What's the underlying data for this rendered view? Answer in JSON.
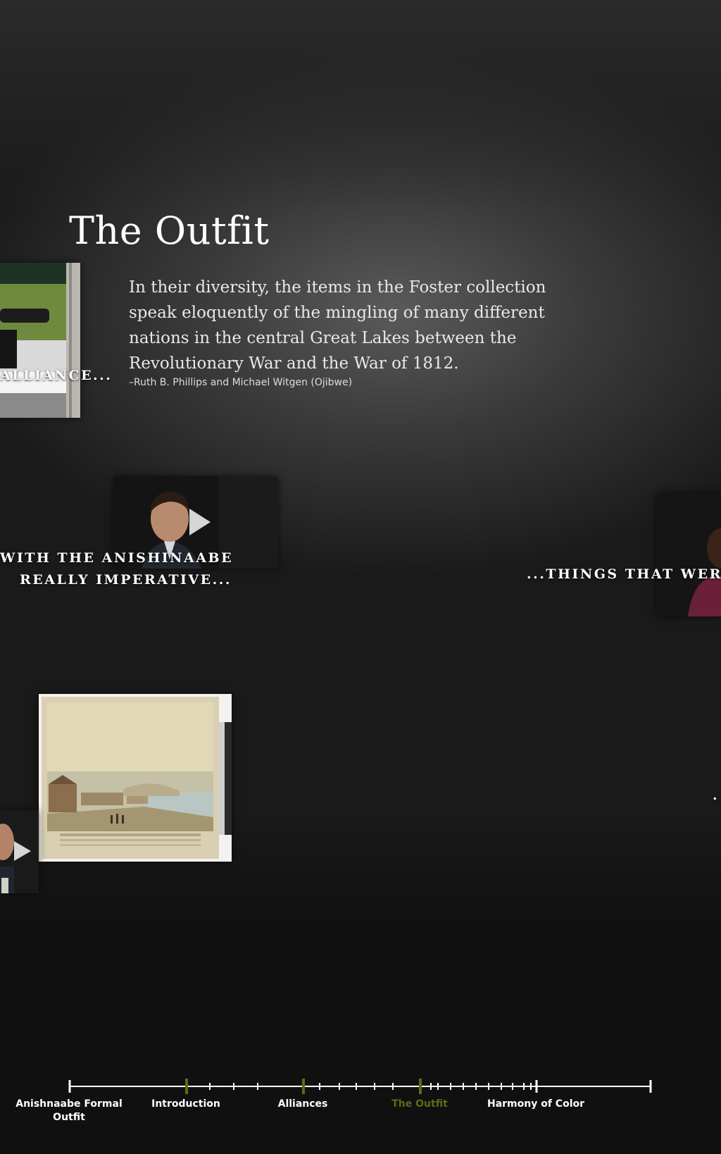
{
  "section": {
    "title": "The Outfit",
    "quote": "In their diversity, the items in the Foster collection speak eloquently of the mingling of many different nations in the central Great Lakes between the Revolutionary War and the War of 1812.",
    "attribution": "–Ruth B. Phillips and Michael Witgen (Ojibwe)"
  },
  "media": {
    "fort_caption": "ALLIANCE...",
    "video_man_caption_1": "WITH THE ANISHINAABE",
    "video_man_caption_2": "REALLY IMPERATIVE...",
    "video_woman_caption": "...THINGS THAT WERE T",
    "stray_caption": "."
  },
  "timeline": {
    "labels": [
      {
        "text": "Anishnaabe Formal Outfit",
        "line1": "Anishnaabe Formal",
        "line2": "Outfit"
      },
      {
        "text": "Introduction"
      },
      {
        "text": "Alliances"
      },
      {
        "text": "The Outfit",
        "active": true
      },
      {
        "text": "Harmony of Color"
      }
    ],
    "colors": {
      "line": "#ffffff",
      "section_marker": "#5d6b14",
      "active_label": "#5d6b14"
    }
  }
}
